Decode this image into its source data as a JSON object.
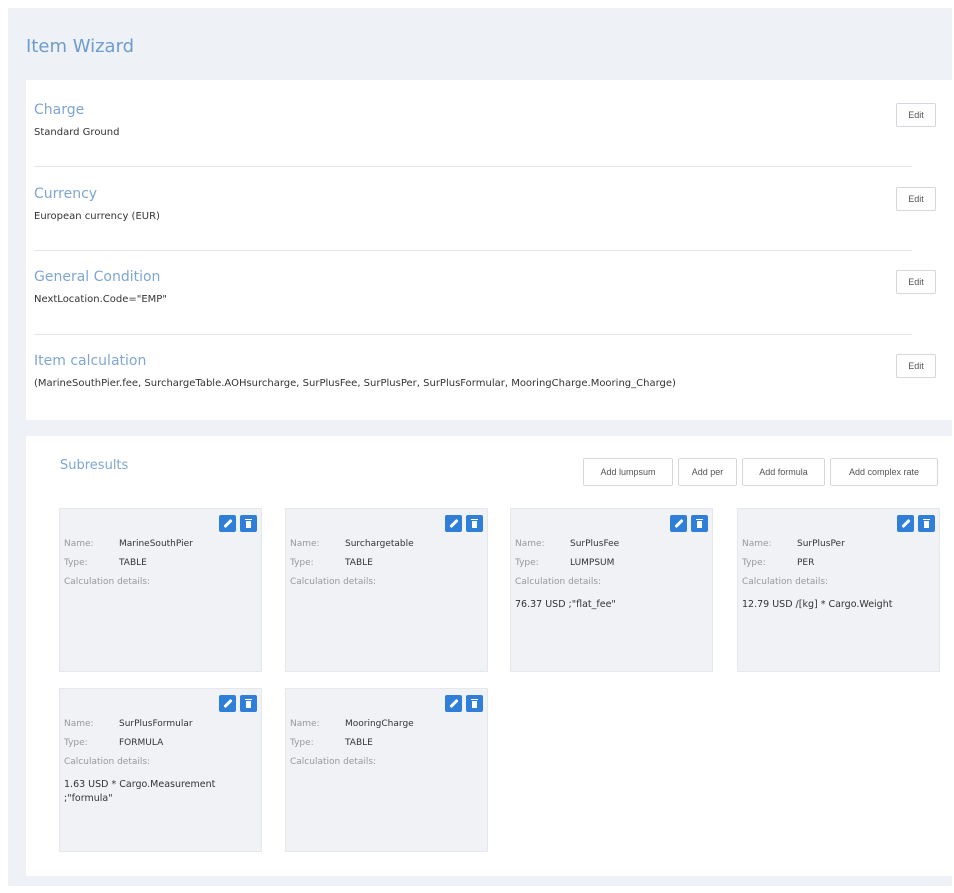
{
  "wizard": {
    "title": "Item Wizard"
  },
  "sections": [
    {
      "title": "Charge",
      "value": "Standard Ground",
      "edit_label": "Edit"
    },
    {
      "title": "Currency",
      "value": "European currency (EUR)",
      "edit_label": "Edit"
    },
    {
      "title": "General Condition",
      "value": "NextLocation.Code=\"EMP\"",
      "edit_label": "Edit"
    },
    {
      "title": "Item calculation",
      "value": "(MarineSouthPier.fee, SurchargeTable.AOHsurcharge, SurPlusFee, SurPlusPer, SurPlusFormular, MooringCharge.Mooring_Charge)",
      "edit_label": "Edit"
    }
  ],
  "subresults": {
    "title": "Subresults",
    "buttons": {
      "add_lumpsum": "Add lumpsum",
      "add_per": "Add per",
      "add_formula": "Add formula",
      "add_complex_rate": "Add complex rate"
    },
    "labels": {
      "name": "Name:",
      "type": "Type:",
      "calc": "Calculation details:"
    },
    "cards": [
      {
        "name": "MarineSouthPier",
        "type": "TABLE",
        "calc": ""
      },
      {
        "name": "Surchargetable",
        "type": "TABLE",
        "calc": ""
      },
      {
        "name": "SurPlusFee",
        "type": "LUMPSUM",
        "calc": "76.37 USD ;\"flat_fee\""
      },
      {
        "name": "SurPlusPer",
        "type": "PER",
        "calc": "12.79 USD /[kg] * Cargo.Weight"
      },
      {
        "name": "SurPlusFormular",
        "type": "FORMULA",
        "calc": "1.63 USD * Cargo.Measurement ;\"formula\""
      },
      {
        "name": "MooringCharge",
        "type": "TABLE",
        "calc": ""
      }
    ]
  },
  "icons": {
    "edit": "pencil-icon",
    "delete": "trash-icon"
  },
  "colors": {
    "accent": "#2f7fd8",
    "title": "#6e9ccc",
    "section_title": "#7fa6d1",
    "background": "#eef2f6"
  }
}
